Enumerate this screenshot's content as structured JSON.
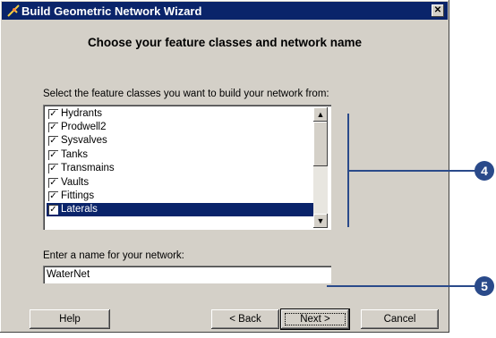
{
  "window": {
    "title": "Build Geometric Network Wizard",
    "close_label": "✕",
    "heading": "Choose your feature classes and network name"
  },
  "feature_classes": {
    "label": "Select the feature classes you want to build your network from:",
    "items": [
      {
        "label": "Hydrants",
        "checked": true
      },
      {
        "label": "Prodwell2",
        "checked": true
      },
      {
        "label": "Sysvalves",
        "checked": true
      },
      {
        "label": "Tanks",
        "checked": true
      },
      {
        "label": "Transmains",
        "checked": true
      },
      {
        "label": "Vaults",
        "checked": true
      },
      {
        "label": "Fittings",
        "checked": true
      },
      {
        "label": "Laterals",
        "checked": true,
        "selected": true
      }
    ]
  },
  "network_name": {
    "label": "Enter a name for your network:",
    "value": "WaterNet"
  },
  "buttons": {
    "help": "Help",
    "back": "< Back",
    "next": "Next >",
    "cancel": "Cancel"
  },
  "callouts": {
    "one": "4",
    "two": "5"
  },
  "colors": {
    "title_bar": "#0a246a",
    "dialog_bg": "#d4d0c8",
    "callout": "#2a4a8a"
  }
}
